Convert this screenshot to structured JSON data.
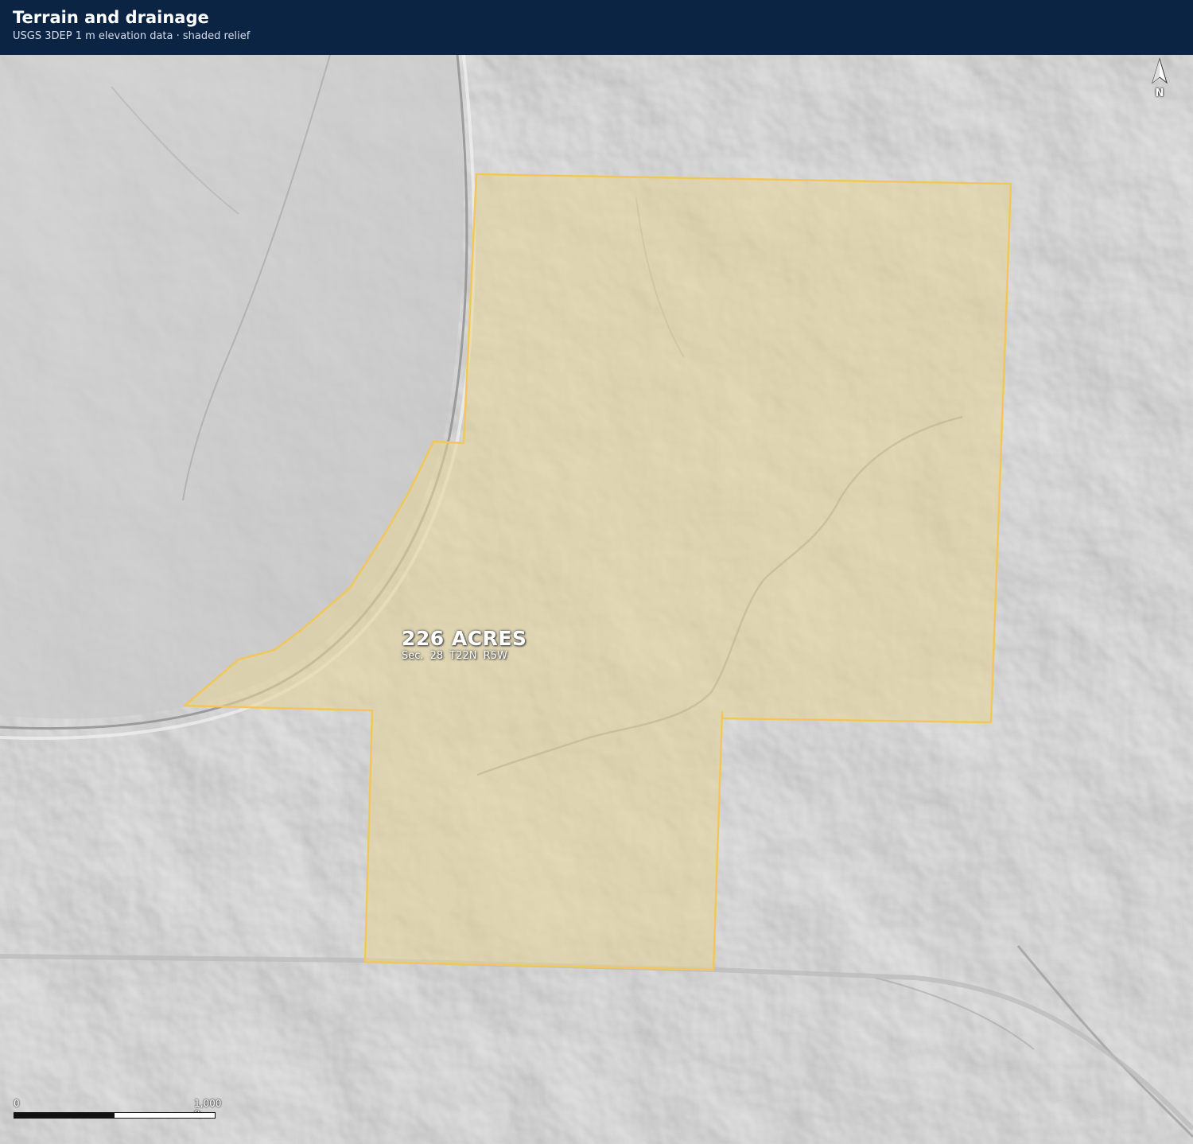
{
  "header": {
    "title": "Terrain and drainage",
    "subtitle": "USGS 3DEP 1 m elevation data · shaded relief"
  },
  "north_arrow": {
    "label": "N",
    "icon": "north-arrow-icon"
  },
  "parcel": {
    "area_label": "226 ACRES",
    "legal_description": "Sec. 28 T22N R5W",
    "fill_color": "#e6d49a",
    "outline_color": "#f2c75a"
  },
  "scale_bar": {
    "start_label": "0",
    "end_label": "1,000 ft"
  },
  "colors": {
    "header_bg": "#0c2444",
    "relief_base": "#c9c9c9"
  }
}
